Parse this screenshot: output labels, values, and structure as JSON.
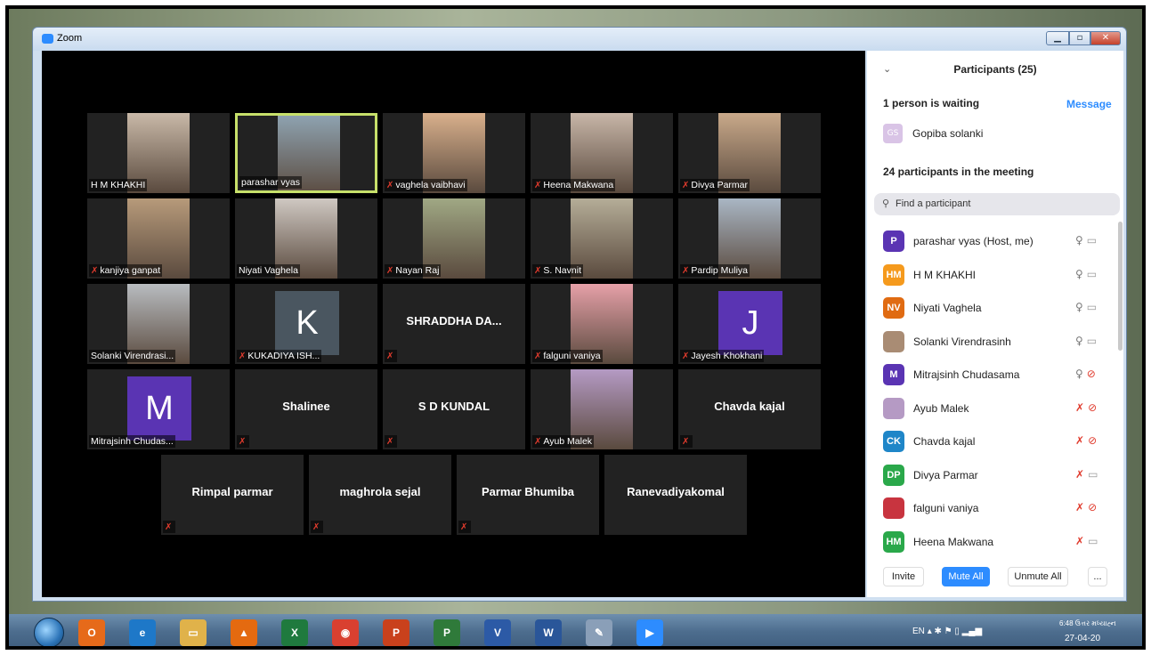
{
  "window": {
    "title": "Zoom",
    "btn_min": "▁",
    "btn_max": "▫",
    "btn_close": "✕"
  },
  "gallery": {
    "tiles": [
      {
        "name": "H M KHAKHI",
        "muted": false,
        "kind": "video",
        "thumb": "#c9b9a8"
      },
      {
        "name": "parashar vyas",
        "muted": false,
        "kind": "video",
        "thumb": "#8ea2b0",
        "active": true
      },
      {
        "name": "vaghela vaibhavi",
        "muted": true,
        "kind": "video",
        "thumb": "#d9b08c"
      },
      {
        "name": "Heena Makwana",
        "muted": true,
        "kind": "video",
        "thumb": "#c8b6a8"
      },
      {
        "name": "Divya Parmar",
        "muted": true,
        "kind": "video",
        "thumb": "#c9a98a"
      },
      {
        "name": "kanjiya ganpat",
        "muted": true,
        "kind": "video",
        "thumb": "#b79a7a"
      },
      {
        "name": "Niyati Vaghela",
        "muted": false,
        "kind": "video",
        "thumb": "#cfc8c2"
      },
      {
        "name": "Nayan Raj",
        "muted": true,
        "kind": "video",
        "thumb": "#a0a884"
      },
      {
        "name": "S. Navnit",
        "muted": true,
        "kind": "video",
        "thumb": "#b5ad98"
      },
      {
        "name": "Pardip Muliya",
        "muted": true,
        "kind": "video",
        "thumb": "#a9b6c4"
      },
      {
        "name": "Solanki Virendrasi...",
        "muted": false,
        "kind": "video",
        "thumb": "#b8bcc0"
      },
      {
        "name": "KUKADIYA ISH...",
        "muted": true,
        "kind": "letter",
        "letter": "K",
        "color": "#4a5660"
      },
      {
        "name": "",
        "muted": true,
        "kind": "name",
        "center": "SHRADDHA DA..."
      },
      {
        "name": "falguni vaniya",
        "muted": true,
        "kind": "video",
        "thumb": "#e6a0a8"
      },
      {
        "name": "Jayesh Khokhani",
        "muted": true,
        "kind": "letter",
        "letter": "J",
        "color": "#5a34b3"
      },
      {
        "name": "Mitrajsinh Chudas...",
        "muted": false,
        "kind": "letter",
        "letter": "M",
        "color": "#5a34b3"
      },
      {
        "name": "",
        "muted": true,
        "kind": "name",
        "center": "Shalinee"
      },
      {
        "name": "",
        "muted": true,
        "kind": "name",
        "center": "S D KUNDAL"
      },
      {
        "name": "Ayub Malek",
        "muted": true,
        "kind": "video",
        "thumb": "#b59ac4"
      },
      {
        "name": "",
        "muted": true,
        "kind": "name",
        "center": "Chavda kajal"
      },
      {
        "name": "",
        "muted": true,
        "kind": "name",
        "center": "Rimpal parmar"
      },
      {
        "name": "",
        "muted": true,
        "kind": "name",
        "center": "maghrola sejal"
      },
      {
        "name": "",
        "muted": true,
        "kind": "name",
        "center": "Parmar Bhumiba"
      },
      {
        "name": "",
        "muted": false,
        "kind": "name",
        "center": "Ranevadiyakomal"
      }
    ]
  },
  "panel": {
    "title": "Participants (25)",
    "waiting_text": "1 person is waiting",
    "message_label": "Message",
    "waiting_person": {
      "initials": "GS",
      "name": "Gopiba solanki"
    },
    "in_meeting_text": "24 participants in the meeting",
    "search_placeholder": "Find a participant",
    "participants": [
      {
        "initials": "P",
        "name": "parashar vyas (Host, me)",
        "color": "#5a34b3",
        "mic_muted": false,
        "video_off": false
      },
      {
        "initials": "HM",
        "name": "H M KHAKHI",
        "color": "#f59a1d",
        "mic_muted": false,
        "video_off": false
      },
      {
        "initials": "NV",
        "name": "Niyati Vaghela",
        "color": "#e06b12",
        "mic_muted": false,
        "video_off": false
      },
      {
        "initials": "",
        "name": "Solanki Virendrasinh",
        "color": "#a98c74",
        "mic_muted": false,
        "video_off": false
      },
      {
        "initials": "M",
        "name": "Mitrajsinh Chudasama",
        "color": "#5a34b3",
        "mic_muted": false,
        "video_off": true
      },
      {
        "initials": "",
        "name": "Ayub Malek",
        "color": "#b59ac4",
        "mic_muted": true,
        "video_off": true
      },
      {
        "initials": "CK",
        "name": "Chavda kajal",
        "color": "#1f86c8",
        "mic_muted": true,
        "video_off": true
      },
      {
        "initials": "DP",
        "name": "Divya Parmar",
        "color": "#2aa84a",
        "mic_muted": true,
        "video_off": false
      },
      {
        "initials": "",
        "name": "falguni vaniya",
        "color": "#c8343f",
        "mic_muted": true,
        "video_off": true
      },
      {
        "initials": "HM",
        "name": "Heena Makwana",
        "color": "#2aa84a",
        "mic_muted": true,
        "video_off": false
      }
    ],
    "btn_invite": "Invite",
    "btn_mute_all": "Mute All",
    "btn_unmute_all": "Unmute All",
    "btn_more": "..."
  },
  "taskbar": {
    "apps": [
      {
        "name": "outlook",
        "label": "O",
        "color": "#e66a1a"
      },
      {
        "name": "internet-explorer",
        "label": "e",
        "color": "#1e78c8"
      },
      {
        "name": "file-explorer",
        "label": "▭",
        "color": "#e0b24a"
      },
      {
        "name": "vlc",
        "label": "▲",
        "color": "#e46a10"
      },
      {
        "name": "excel",
        "label": "X",
        "color": "#1f7a3e"
      },
      {
        "name": "chrome",
        "label": "◉",
        "color": "#d94030"
      },
      {
        "name": "powerpoint",
        "label": "P",
        "color": "#c9411c"
      },
      {
        "name": "project",
        "label": "P",
        "color": "#2f7a3a"
      },
      {
        "name": "visio",
        "label": "V",
        "color": "#2c5aa6"
      },
      {
        "name": "word",
        "label": "W",
        "color": "#2a5699"
      },
      {
        "name": "paint",
        "label": "✎",
        "color": "#8a9fb8"
      },
      {
        "name": "zoom",
        "label": "▶",
        "color": "#2d8cff"
      }
    ],
    "lang": "EN",
    "time": "6:48 ઉત્તર મધ્યાહ્ન",
    "date": "27-04-20"
  }
}
